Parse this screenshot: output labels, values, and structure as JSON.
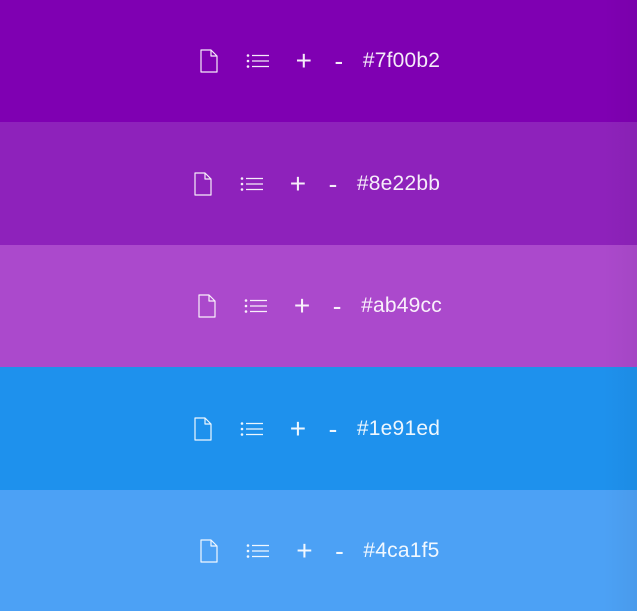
{
  "swatches": [
    {
      "hex": "#7f00b2",
      "color": "#7f00b2",
      "icons": [
        "document-icon",
        "list-icon"
      ],
      "plus_label": "+",
      "minus_label": "-"
    },
    {
      "hex": "#8e22bb",
      "color": "#8e22bb",
      "icons": [
        "document-icon",
        "list-icon"
      ],
      "plus_label": "+",
      "minus_label": "-"
    },
    {
      "hex": "#ab49cc",
      "color": "#ab49cc",
      "icons": [
        "document-icon",
        "list-icon"
      ],
      "plus_label": "+",
      "minus_label": "-"
    },
    {
      "hex": "#1e91ed",
      "color": "#1e91ed",
      "icons": [
        "document-icon",
        "list-icon"
      ],
      "plus_label": "+",
      "minus_label": "-"
    },
    {
      "hex": "#4ca1f5",
      "color": "#4ca1f5",
      "icons": [
        "document-icon",
        "list-icon"
      ],
      "plus_label": "+",
      "minus_label": "-"
    }
  ]
}
